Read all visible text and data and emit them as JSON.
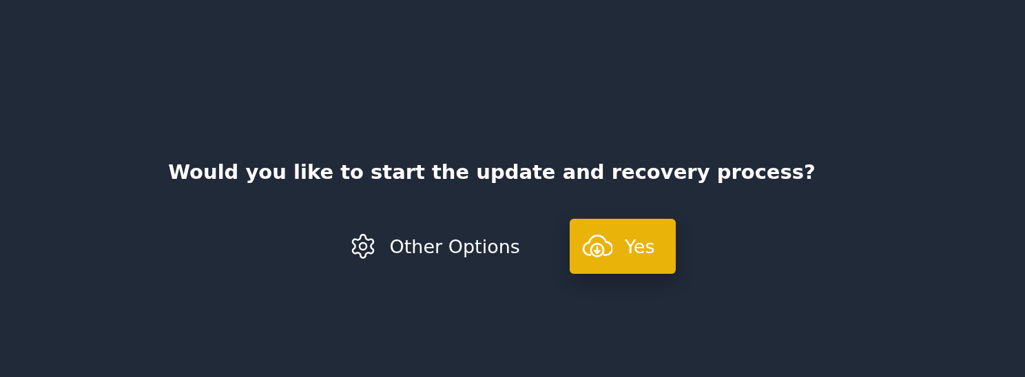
{
  "prompt": {
    "question": "Would you like to start the update and recovery process?"
  },
  "buttons": [
    {
      "label": "Other Options",
      "kind": "secondary"
    },
    {
      "label": "Yes",
      "kind": "primary"
    }
  ]
}
